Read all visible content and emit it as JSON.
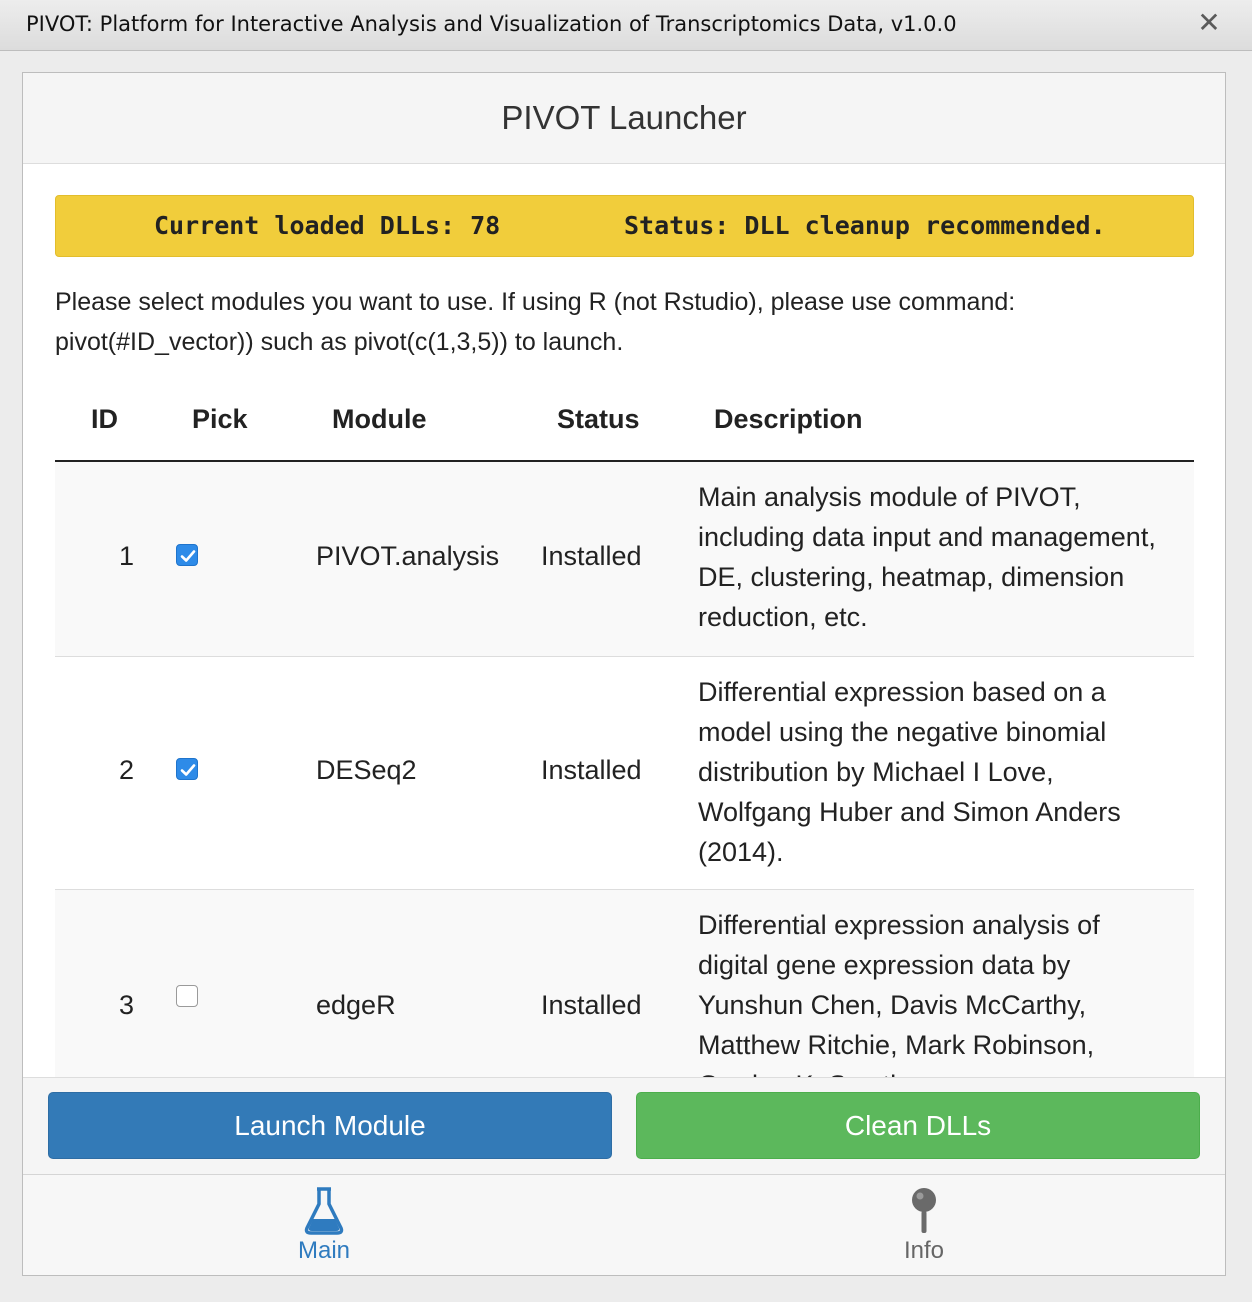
{
  "window": {
    "title": "PIVOT: Platform for Interactive Analysis and Visualization of Transcriptomics Data, v1.0.0",
    "close_glyph": "✕"
  },
  "header": {
    "title": "PIVOT Launcher"
  },
  "dll_status": {
    "loaded_text": "Current loaded DLLs: 78",
    "status_text": "Status: DLL cleanup recommended.",
    "color": "#f1cd3b"
  },
  "instructions": {
    "line1": "Please select modules you want to use. If using R (not Rstudio), please use command:",
    "line2": "pivot(#ID_vector)) such as pivot(c(1,3,5)) to launch."
  },
  "table": {
    "columns": [
      "ID",
      "Pick",
      "Module",
      "Status",
      "Description"
    ],
    "rows": [
      {
        "id": "1",
        "picked": true,
        "module": "PIVOT.analysis",
        "status": "Installed",
        "description": "Main analysis module of PIVOT, including data input and management, DE, clustering, heatmap, dimension reduction, etc."
      },
      {
        "id": "2",
        "picked": true,
        "module": "DESeq2",
        "status": "Installed",
        "description": "Differential expression based on a model using the negative binomial distribution by Michael I Love, Wolfgang Huber and Simon Anders (2014)."
      },
      {
        "id": "3",
        "picked": false,
        "module": "edgeR",
        "status": "Installed",
        "description": "Differential expression analysis of digital gene expression data by Yunshun Chen, Davis McCarthy, Matthew Ritchie, Mark Robinson, Gordon K. Smyth"
      }
    ]
  },
  "buttons": {
    "launch_label": "Launch Module",
    "clean_label": "Clean DLLs",
    "launch_color": "#337ab7",
    "clean_color": "#5cb85c"
  },
  "tabs": [
    {
      "label": "Main",
      "icon": "flask-icon",
      "active": true,
      "color": "#2f7bbf"
    },
    {
      "label": "Info",
      "icon": "pin-icon",
      "active": false,
      "color": "#666666"
    }
  ]
}
